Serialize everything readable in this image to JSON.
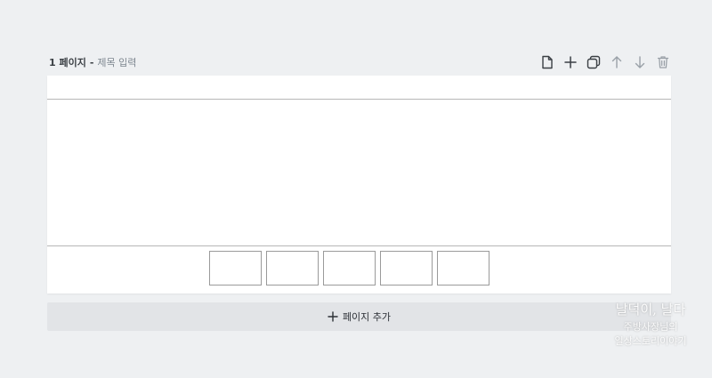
{
  "page": {
    "number_label": "1 페이지",
    "separator": "-",
    "title_placeholder": "제목 입력"
  },
  "toolbar": {
    "items": [
      {
        "icon": "new-page-icon"
      },
      {
        "icon": "add-icon"
      },
      {
        "icon": "duplicate-icon"
      },
      {
        "icon": "move-up-icon"
      },
      {
        "icon": "move-down-icon"
      },
      {
        "icon": "trash-icon"
      }
    ]
  },
  "thumbnails": {
    "count": 5
  },
  "add_page": {
    "label": "페이지 추가"
  },
  "watermark": {
    "line1": "날덕이, 날다",
    "line2": "주방사장님의",
    "line3": "일상스토리이야기"
  },
  "colors": {
    "background": "#eef0f2",
    "canvas": "#ffffff",
    "add_button_bg": "#e2e4e7",
    "muted_text": "#7e8790"
  }
}
